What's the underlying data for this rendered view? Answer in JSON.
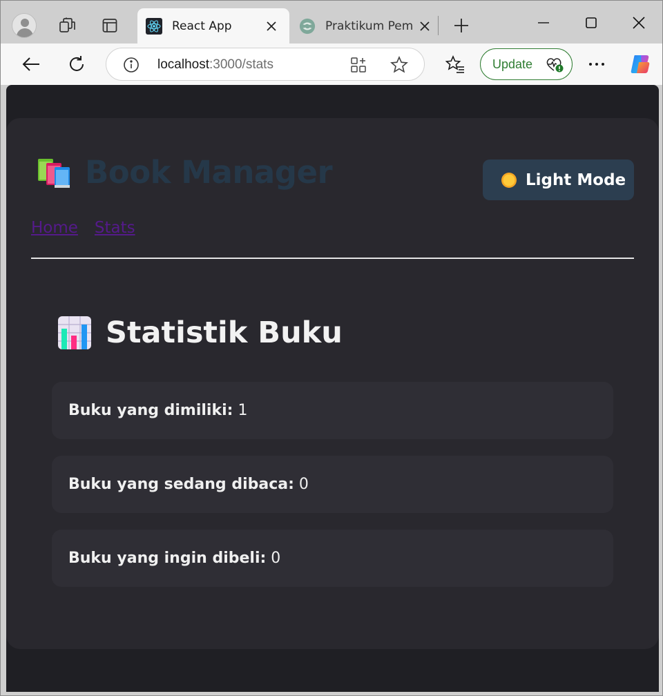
{
  "browser": {
    "tabs": [
      {
        "title": "React App",
        "active": true
      },
      {
        "title": "Praktikum Pemr",
        "active": false
      }
    ],
    "address": {
      "host": "localhost",
      "path": ":3000/stats"
    },
    "update_label": "Update"
  },
  "app": {
    "brand_title": "Book Manager",
    "theme_toggle_label": "Light Mode",
    "nav": [
      {
        "label": "Home"
      },
      {
        "label": "Stats"
      }
    ],
    "page_title": "Statistik Buku",
    "stats": [
      {
        "label": "Buku yang dimiliki:",
        "value": "1"
      },
      {
        "label": "Buku yang sedang dibaca:",
        "value": "0"
      },
      {
        "label": "Buku yang ingin dibeli:",
        "value": "0"
      }
    ]
  },
  "colors": {
    "page_background": "#1f1f24",
    "card_background": "#29282e",
    "stat_card_background": "#2f2e35",
    "theme_button": "#2c3e50",
    "brand_text": "#253849",
    "link_visited": "#551a8b",
    "update_green": "#2f7d32"
  },
  "icons": {
    "brand": "books-icon",
    "theme_toggle": "sun-icon",
    "page_title": "bar-chart-icon"
  }
}
